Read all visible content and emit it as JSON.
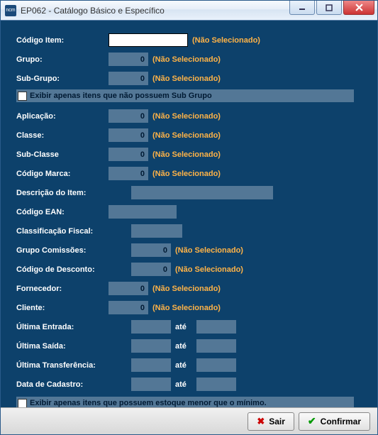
{
  "window": {
    "title": "EP062 - Catálogo Básico e Específico",
    "app_icon_text": "ncm"
  },
  "hints": {
    "not_selected": "(Não Selecionado)"
  },
  "labels": {
    "codigo_item": "Código Item:",
    "grupo": "Grupo:",
    "sub_grupo": "Sub-Grupo:",
    "aplicacao": "Aplicação:",
    "classe": "Classe:",
    "sub_classe": "Sub-Classe",
    "codigo_marca": "Código Marca:",
    "descricao": "Descrição do Item:",
    "codigo_ean": "Código EAN:",
    "class_fiscal": "Classificação Fiscal:",
    "grupo_comissoes": "Grupo Comissões:",
    "codigo_desconto": "Código de Desconto:",
    "fornecedor": "Fornecedor:",
    "cliente": "Cliente:",
    "ultima_entrada": "Última Entrada:",
    "ultima_saida": "Última Saída:",
    "ultima_transf": "Última Transferência:",
    "data_cadastro": "Data de Cadastro:",
    "ate": "até"
  },
  "values": {
    "codigo_item": "",
    "grupo": "0",
    "sub_grupo": "0",
    "aplicacao": "0",
    "classe": "0",
    "sub_classe": "0",
    "codigo_marca": "0",
    "descricao": "",
    "codigo_ean": "",
    "class_fiscal": "",
    "grupo_comissoes": "0",
    "codigo_desconto": "0",
    "fornecedor": "0",
    "cliente": "0",
    "ultima_entrada_de": "",
    "ultima_entrada_ate": "",
    "ultima_saida_de": "",
    "ultima_saida_ate": "",
    "ultima_transf_de": "",
    "ultima_transf_ate": "",
    "data_cadastro_de": "",
    "data_cadastro_ate": ""
  },
  "checkboxes": {
    "sem_subgrupo": "Exibir apenas itens que não possuem Sub Grupo",
    "estoque_minimo": "Exibir apenas itens que possuem estoque menor que o mínimo."
  },
  "buttons": {
    "sair": "Sair",
    "confirmar": "Confirmar"
  }
}
